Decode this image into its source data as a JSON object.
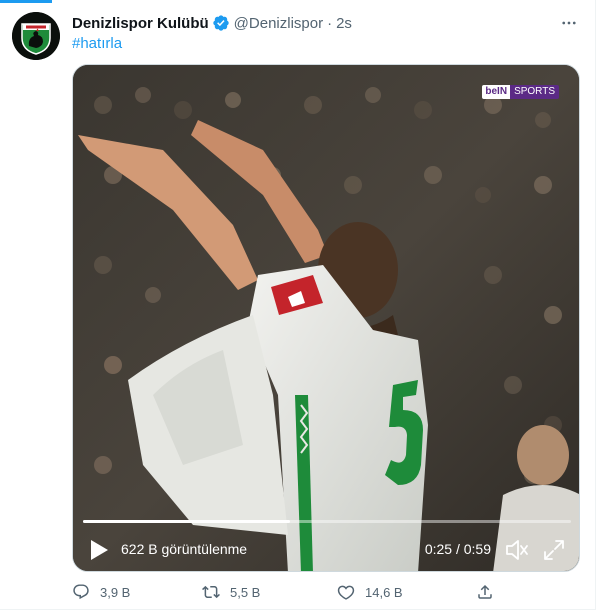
{
  "account": {
    "display_name": "Denizlispor Kulübü",
    "handle": "@Denizlispor",
    "separator": "·",
    "time": "2s",
    "verified": true,
    "avatar_icon": "denizlispor-rooster-crest",
    "avatar_text": "DENIZLISPOR"
  },
  "tweet": {
    "hashtag": "#hatırla"
  },
  "video": {
    "broadcaster_logo": {
      "part1": "beIN",
      "part2": "SPORTS"
    },
    "views_label": "622 B görüntülenme",
    "timecode": "0:25 / 0:59",
    "progress_fraction": 0.424,
    "play_icon": "play-icon",
    "volume_icon": "volume-muted-icon",
    "fullscreen_icon": "fullscreen-icon"
  },
  "actions": {
    "reply_count": "3,9 B",
    "retweet_count": "5,5 B",
    "like_count": "14,6 B"
  },
  "colors": {
    "accent": "#1d9bf0",
    "secondary_text": "#536471",
    "primary_text": "#0f1419",
    "bein_purple": "#5b2a86",
    "jersey_green": "#1e8b3a"
  }
}
